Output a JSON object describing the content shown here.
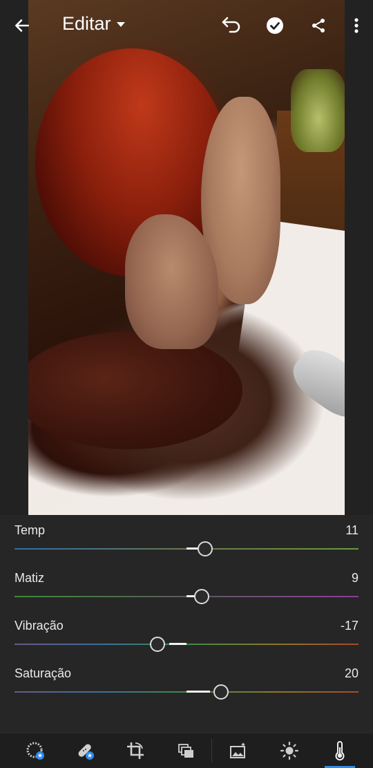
{
  "header": {
    "title": "Editar",
    "back_icon": "arrow-left-icon",
    "dropdown_icon": "caret-down-icon",
    "undo_icon": "undo-icon",
    "done_icon": "check-circle-icon",
    "share_icon": "share-icon",
    "more_icon": "more-vertical-icon"
  },
  "sliders": [
    {
      "label": "Temp",
      "value": "11"
    },
    {
      "label": "Matiz",
      "value": "9"
    },
    {
      "label": "Vibração",
      "value": "-17"
    },
    {
      "label": "Saturação",
      "value": "20"
    }
  ],
  "toolbar": {
    "tools": [
      {
        "icon": "presets-dial-icon",
        "premium": true
      },
      {
        "icon": "healing-bandage-icon",
        "premium": true
      },
      {
        "icon": "crop-icon"
      },
      {
        "icon": "layers-icon"
      },
      {
        "icon": "auto-image-icon"
      },
      {
        "icon": "light-sun-icon"
      },
      {
        "icon": "color-thermometer-icon",
        "active": true
      }
    ],
    "accent_color": "#2d8ceb"
  }
}
